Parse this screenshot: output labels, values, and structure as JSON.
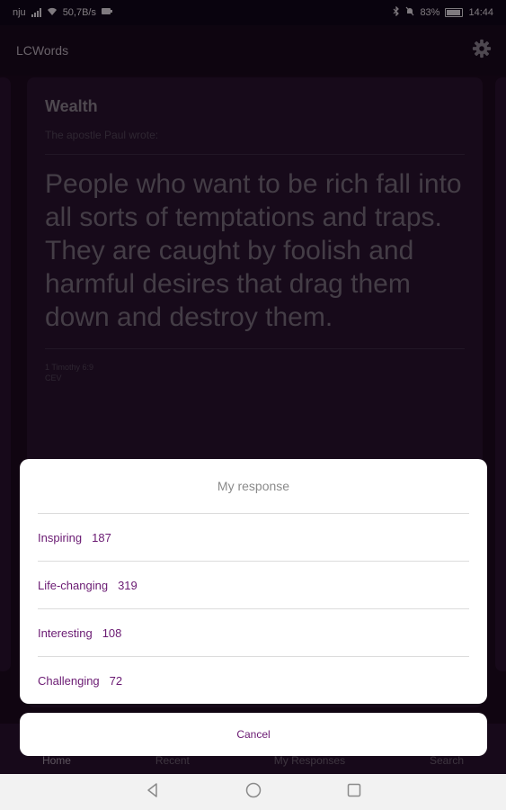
{
  "status_bar": {
    "carrier": "nju",
    "speed": "50,7B/s",
    "battery_percent": "83%",
    "time": "14:44"
  },
  "app_bar": {
    "title": "LCWords",
    "settings_icon": "gear-icon"
  },
  "card": {
    "title": "Wealth",
    "intro": "The apostle Paul wrote:",
    "quote": "People who want to be rich fall into all sorts of temptations and traps. They are caught by foolish and harmful desires that drag them down and destroy them.",
    "reference": "1 Timothy 6:9",
    "version": "CEV"
  },
  "bottom_nav": {
    "items": [
      {
        "label": "Home",
        "active": true
      },
      {
        "label": "Recent",
        "active": false
      },
      {
        "label": "My Responses",
        "active": false
      },
      {
        "label": "Search",
        "active": false
      }
    ]
  },
  "response_sheet": {
    "title": "My response",
    "options": [
      {
        "label": "Inspiring",
        "count": "187"
      },
      {
        "label": "Life-changing",
        "count": "319"
      },
      {
        "label": "Interesting",
        "count": "108"
      },
      {
        "label": "Challenging",
        "count": "72"
      }
    ],
    "cancel_label": "Cancel"
  },
  "system_nav": {
    "icons": [
      "back-icon",
      "home-icon",
      "recents-icon"
    ]
  },
  "colors": {
    "background": "#1e0a1f",
    "card": "#2b1330",
    "accent": "#6a1a72"
  }
}
